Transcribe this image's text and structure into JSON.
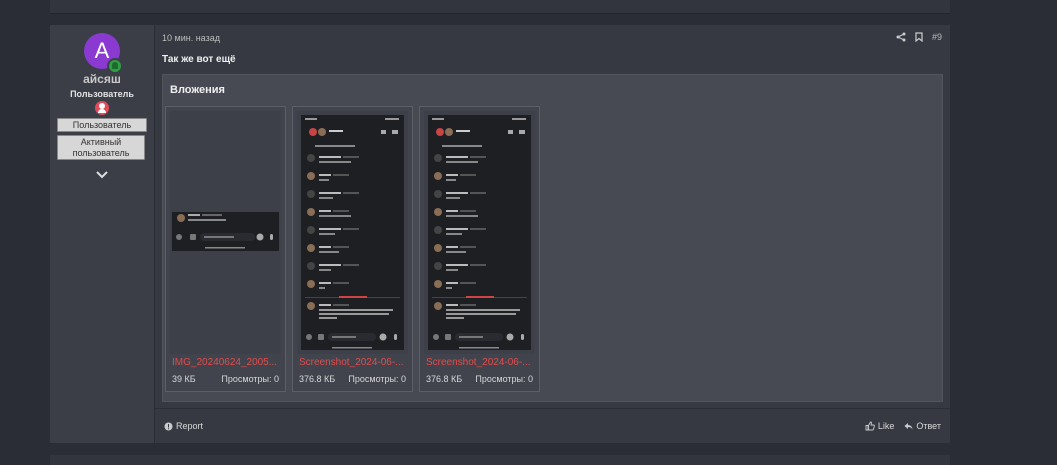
{
  "post": {
    "author": {
      "avatar_letter": "A",
      "username": "айсяш",
      "user_title": "Пользователь",
      "banners": [
        "Пользователь",
        "Активный пользователь"
      ]
    },
    "time": "10 мин. назад",
    "number": "#9",
    "message": "Так же вот ещё",
    "attachments_title": "Вложения",
    "attachments": [
      {
        "name": "IMG_20240624_2005...",
        "size": "39 КБ",
        "views": "Просмотры: 0"
      },
      {
        "name": "Screenshot_2024-06-...",
        "size": "376.8 КБ",
        "views": "Просмотры: 0"
      },
      {
        "name": "Screenshot_2024-06-...",
        "size": "376.8 КБ",
        "views": "Просмотры: 0"
      }
    ],
    "footer": {
      "report": "Report",
      "like": "Like",
      "reply": "Ответ"
    }
  },
  "colors": {
    "accent_link": "#e54b4b",
    "avatar": "#8a3ad0",
    "online": "#2f9e44"
  },
  "icons": [
    "share-icon",
    "bookmark-icon",
    "chevron-down-icon",
    "report-icon",
    "like-icon",
    "reply-icon"
  ]
}
